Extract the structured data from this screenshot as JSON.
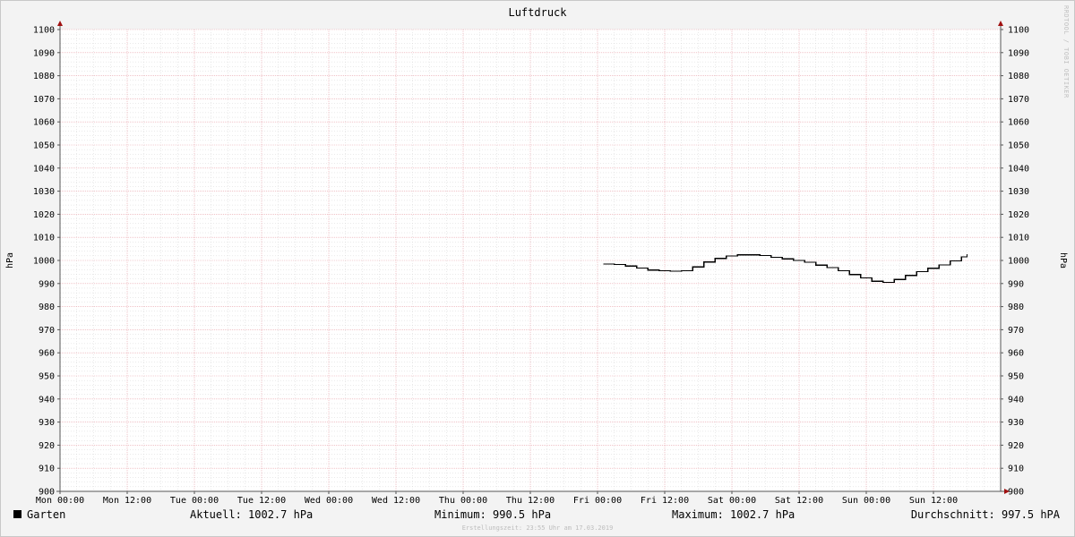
{
  "chart_data": {
    "type": "line",
    "title": "Luftdruck",
    "ylabel": "hPa",
    "ylabel_right": "hPa",
    "ylim": [
      900,
      1100
    ],
    "yticks": [
      900,
      910,
      920,
      930,
      940,
      950,
      960,
      970,
      980,
      990,
      1000,
      1010,
      1020,
      1030,
      1040,
      1050,
      1060,
      1070,
      1080,
      1090,
      1100
    ],
    "xlim_hours": [
      0,
      168
    ],
    "xticks": [
      {
        "hour": 0,
        "label": "Mon 00:00"
      },
      {
        "hour": 12,
        "label": "Mon 12:00"
      },
      {
        "hour": 24,
        "label": "Tue 00:00"
      },
      {
        "hour": 36,
        "label": "Tue 12:00"
      },
      {
        "hour": 48,
        "label": "Wed 00:00"
      },
      {
        "hour": 60,
        "label": "Wed 12:00"
      },
      {
        "hour": 72,
        "label": "Thu 00:00"
      },
      {
        "hour": 84,
        "label": "Thu 12:00"
      },
      {
        "hour": 96,
        "label": "Fri 00:00"
      },
      {
        "hour": 108,
        "label": "Fri 12:00"
      },
      {
        "hour": 120,
        "label": "Sat 00:00"
      },
      {
        "hour": 132,
        "label": "Sat 12:00"
      },
      {
        "hour": 144,
        "label": "Sun 00:00"
      },
      {
        "hour": 156,
        "label": "Sun 12:00"
      }
    ],
    "grid": true,
    "series": [
      {
        "name": "Garten",
        "color": "#000000",
        "points": [
          [
            97.0,
            998.5
          ],
          [
            99.0,
            998.2
          ],
          [
            101.0,
            997.6
          ],
          [
            103.0,
            996.7
          ],
          [
            105.0,
            995.8
          ],
          [
            107.0,
            995.5
          ],
          [
            109.0,
            995.4
          ],
          [
            111.0,
            995.6
          ],
          [
            113.0,
            997.2
          ],
          [
            115.0,
            999.3
          ],
          [
            117.0,
            1000.9
          ],
          [
            119.0,
            1001.9
          ],
          [
            121.0,
            1002.4
          ],
          [
            123.0,
            1002.4
          ],
          [
            125.0,
            1002.1
          ],
          [
            127.0,
            1001.3
          ],
          [
            129.0,
            1000.7
          ],
          [
            131.0,
            1000.0
          ],
          [
            133.0,
            999.2
          ],
          [
            135.0,
            998.0
          ],
          [
            137.0,
            996.9
          ],
          [
            139.0,
            995.5
          ],
          [
            141.0,
            993.9
          ],
          [
            143.0,
            992.5
          ],
          [
            145.0,
            991.0
          ],
          [
            147.0,
            990.5
          ],
          [
            149.0,
            991.8
          ],
          [
            151.0,
            993.5
          ],
          [
            153.0,
            995.1
          ],
          [
            155.0,
            996.6
          ],
          [
            157.0,
            998.1
          ],
          [
            159.0,
            999.8
          ],
          [
            161.0,
            1001.6
          ],
          [
            162.0,
            1002.7
          ]
        ]
      }
    ],
    "legend": {
      "position": "bottom",
      "series_name": "Garten",
      "current": "Aktuell: 1002.7 hPa",
      "minimum": "Minimum: 990.5 hPa",
      "maximum": "Maximum: 1002.7 hPa",
      "average": "Durchschnitt: 997.5 hPA"
    },
    "watermark": "RRDTOOL / TOBI OETIKER",
    "footer": "Erstellungszeit: 23:55 Uhr am 17.03.2019"
  },
  "colors": {
    "background": "#f3f3f3",
    "plot_background": "#ffffff",
    "major_grid": "#e8a0a8",
    "minor_grid": "#d4d4d4",
    "axis": "#555555",
    "arrow": "#a01010",
    "line": "#000000"
  }
}
